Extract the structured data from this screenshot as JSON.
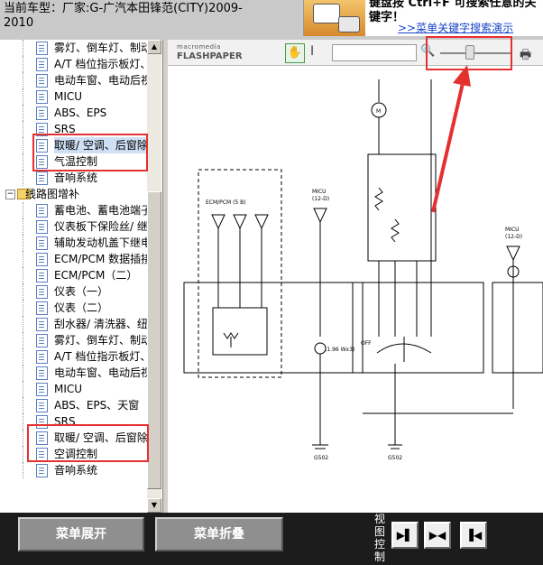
{
  "header": {
    "vehicle_line1": "当前车型：厂家:G-广汽本田锋范(CITY)2009-",
    "vehicle_line2": "2010",
    "banner_text": "键盘按 Ctrl+F 可搜索任意的关键字！",
    "banner_link": ">>菜单关键字搜索演示"
  },
  "tree": {
    "items": [
      {
        "label": "雾灯、倒车灯、制动",
        "type": "doc"
      },
      {
        "label": "A/T 档位指示板灯、",
        "type": "doc"
      },
      {
        "label": "电动车窗、电动后视",
        "type": "doc"
      },
      {
        "label": "MICU",
        "type": "doc"
      },
      {
        "label": "ABS、EPS",
        "type": "doc"
      },
      {
        "label": "SRS",
        "type": "doc"
      },
      {
        "label": "取暖/ 空调、后窗除",
        "type": "doc",
        "selected": true
      },
      {
        "label": "气温控制",
        "type": "doc"
      },
      {
        "label": "音响系统",
        "type": "doc"
      },
      {
        "label": "线路图增补",
        "type": "folder"
      },
      {
        "label": "蓄电池、蓄电池端子",
        "type": "doc"
      },
      {
        "label": "仪表板下保险丝/ 继",
        "type": "doc"
      },
      {
        "label": "辅助发动机盖下继电",
        "type": "doc"
      },
      {
        "label": "ECM/PCM 数据插接",
        "type": "doc"
      },
      {
        "label": "ECM/PCM（二）",
        "type": "doc"
      },
      {
        "label": "仪表（一）",
        "type": "doc"
      },
      {
        "label": "仪表（二）",
        "type": "doc"
      },
      {
        "label": "刮水器/ 清洗器、纽",
        "type": "doc"
      },
      {
        "label": "雾灯、倒车灯、制动",
        "type": "doc"
      },
      {
        "label": "A/T 档位指示板灯、",
        "type": "doc"
      },
      {
        "label": "电动车窗、电动后视",
        "type": "doc"
      },
      {
        "label": "MICU",
        "type": "doc"
      },
      {
        "label": "ABS、EPS、天窗",
        "type": "doc"
      },
      {
        "label": "SRS",
        "type": "doc"
      },
      {
        "label": "取暖/ 空调、后窗除",
        "type": "doc"
      },
      {
        "label": "空调控制",
        "type": "doc"
      },
      {
        "label": "音响系统",
        "type": "doc"
      }
    ]
  },
  "viewer": {
    "brand_top": "macromedia",
    "brand_name": "FLASHPAPER",
    "zoom_level": 0.4
  },
  "diagram": {
    "labels": {
      "ecm": "ECM/PCM (5 B)",
      "micu_left": "MICU",
      "micu_left_sub": "(12-D)",
      "micu_right": "MICU",
      "micu_right_sub": "(12-D)",
      "motor": "M",
      "off": "OFF",
      "lamp": "(1.96 Wx3)",
      "g502_a": "G502",
      "g502_b": "G502"
    }
  },
  "bottom": {
    "expand_label": "菜单展开",
    "collapse_label": "菜单折叠",
    "view_control": "视图控制"
  },
  "colors": {
    "highlight": "#e53030",
    "link": "#1a44c8",
    "bottom_bg": "#1c1c1c"
  }
}
